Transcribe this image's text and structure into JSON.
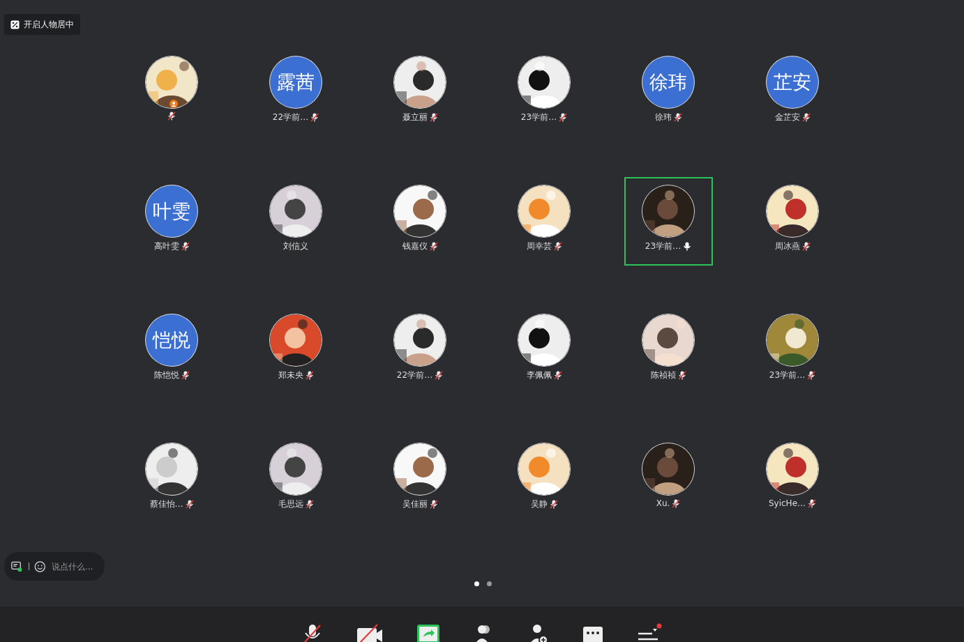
{
  "center_toggle": {
    "label": "开启人物居中"
  },
  "participants": [
    {
      "muted": true,
      "host": true,
      "selected": false
    },
    {
      "name": "22学前…",
      "avatar": {
        "kind": "text",
        "text": "露茜"
      },
      "muted": true,
      "host": false,
      "selected": false
    },
    {
      "name": "聂立丽",
      "muted": true,
      "host": false,
      "selected": false
    },
    {
      "name": "23学前…",
      "muted": true,
      "host": false,
      "selected": false
    },
    {
      "name": "徐玮",
      "avatar": {
        "kind": "text",
        "text": "徐玮"
      },
      "muted": true,
      "host": false,
      "selected": false
    },
    {
      "name": "金芷安",
      "avatar": {
        "kind": "text",
        "text": "芷安"
      },
      "muted": true,
      "host": false,
      "selected": false
    },
    {
      "name": "高叶雯",
      "avatar": {
        "kind": "text",
        "text": "叶雯"
      },
      "muted": true,
      "host": false,
      "selected": false
    },
    {
      "name": "刘信义",
      "selected": false
    },
    {
      "name": "钱嘉仪",
      "muted": true,
      "host": false,
      "selected": false
    },
    {
      "name": "周幸芸",
      "muted": true,
      "host": false,
      "selected": false
    },
    {
      "name": "23学前…",
      "muted": false,
      "host": false,
      "selected": true
    },
    {
      "name": "周冰燕",
      "muted": true,
      "host": false,
      "selected": false
    },
    {
      "name": "陈恺悦",
      "avatar": {
        "kind": "text",
        "text": "恺悦"
      },
      "muted": true,
      "host": false,
      "selected": false
    },
    {
      "name": "郑未央",
      "muted": true,
      "host": false,
      "selected": false
    },
    {
      "name": "22学前…",
      "muted": true,
      "host": false,
      "selected": false
    },
    {
      "name": "李佩佩",
      "muted": true,
      "host": false,
      "selected": false
    },
    {
      "name": "陈祯祯",
      "muted": true,
      "host": false,
      "selected": false
    },
    {
      "name": "23学前…",
      "muted": true,
      "host": false,
      "selected": false
    },
    {
      "name": "蔡佳怡…",
      "muted": true,
      "host": false,
      "selected": false
    },
    {
      "name": "毛思远",
      "muted": true,
      "host": false,
      "selected": false
    },
    {
      "name": "吴佳丽",
      "muted": true,
      "host": false,
      "selected": false
    },
    {
      "name": "吴静",
      "muted": true,
      "host": false,
      "selected": false
    },
    {
      "name": "Xu.",
      "muted": true,
      "host": false,
      "selected": false
    },
    {
      "name": "SyicHe…",
      "muted": true,
      "host": false,
      "selected": false
    }
  ],
  "chat_box": {
    "placeholder": "说点什么..."
  },
  "pages": [
    {
      "selected": true
    },
    {
      "selected": false
    }
  ],
  "toolbar": [
    {
      "kind": "mic",
      "off": true
    },
    {
      "kind": "camera",
      "off": true
    },
    {
      "kind": "share"
    },
    {
      "kind": "participants"
    },
    {
      "kind": "invite"
    },
    {
      "kind": "more"
    },
    {
      "kind": "settings",
      "badge": true
    }
  ]
}
